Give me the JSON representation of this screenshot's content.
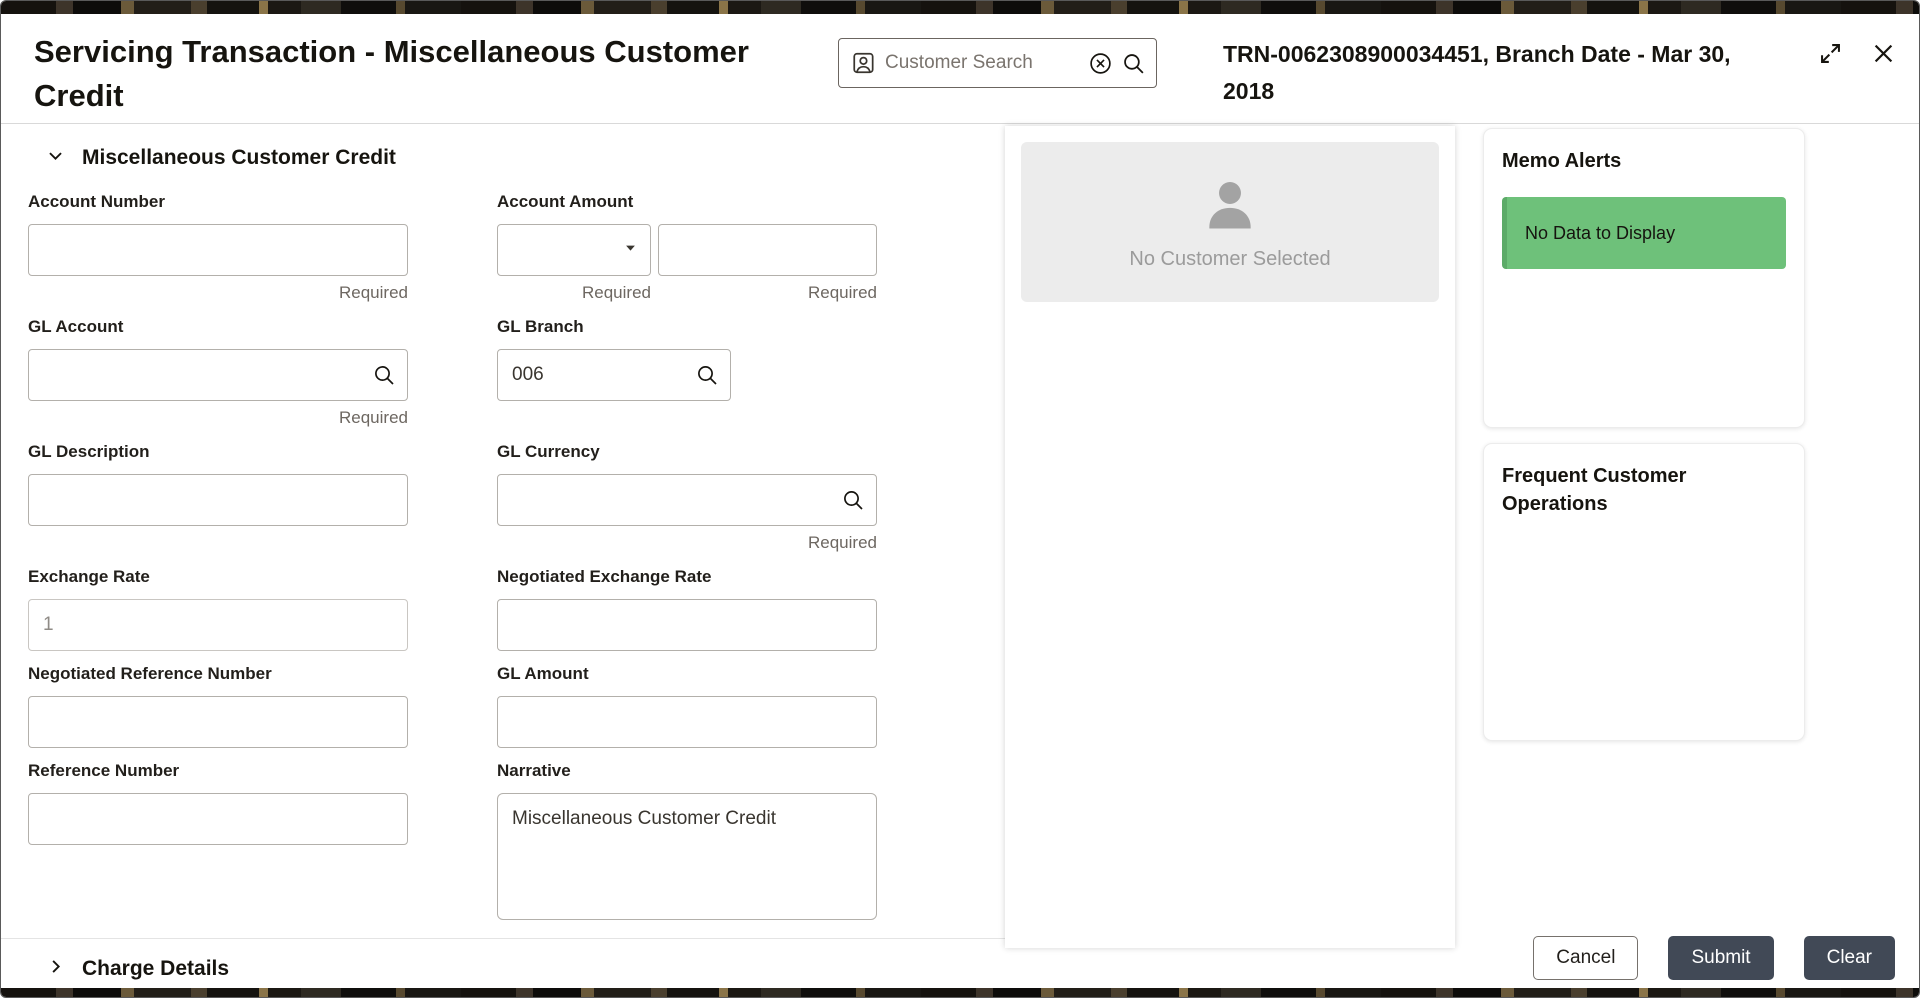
{
  "header": {
    "title": "Servicing Transaction - Miscellaneous Customer Credit",
    "customer_search": {
      "placeholder": "Customer Search"
    },
    "transaction_info": "TRN-0062308900034451, Branch Date - Mar 30, 2018"
  },
  "form": {
    "section_title": "Miscellaneous Customer Credit",
    "charge_section_title": "Charge Details",
    "fields": {
      "account_number": {
        "label": "Account Number",
        "value": "",
        "required": "Required"
      },
      "account_amount": {
        "label": "Account Amount",
        "currency_value": "",
        "amount_value": "",
        "currency_required": "Required",
        "amount_required": "Required"
      },
      "gl_account": {
        "label": "GL Account",
        "value": "",
        "required": "Required"
      },
      "gl_branch": {
        "label": "GL Branch",
        "value": "006"
      },
      "gl_description": {
        "label": "GL Description",
        "value": ""
      },
      "gl_currency": {
        "label": "GL Currency",
        "value": "",
        "required": "Required"
      },
      "exchange_rate": {
        "label": "Exchange Rate",
        "value": "1"
      },
      "negotiated_exchange_rate": {
        "label": "Negotiated Exchange Rate",
        "value": ""
      },
      "negotiated_reference_number": {
        "label": "Negotiated Reference Number",
        "value": ""
      },
      "gl_amount": {
        "label": "GL Amount",
        "value": ""
      },
      "reference_number": {
        "label": "Reference Number",
        "value": ""
      },
      "narrative": {
        "label": "Narrative",
        "value": "Miscellaneous Customer Credit"
      }
    }
  },
  "customer_panel": {
    "empty_message": "No Customer Selected"
  },
  "memo_alerts": {
    "title": "Memo Alerts",
    "empty_message": "No Data to Display"
  },
  "frequent_operations": {
    "title": "Frequent Customer Operations"
  },
  "actions": {
    "cancel": "Cancel",
    "submit": "Submit",
    "clear": "Clear"
  },
  "colors": {
    "memo_badge_green": "#6ec17a",
    "primary_button": "#414956"
  }
}
